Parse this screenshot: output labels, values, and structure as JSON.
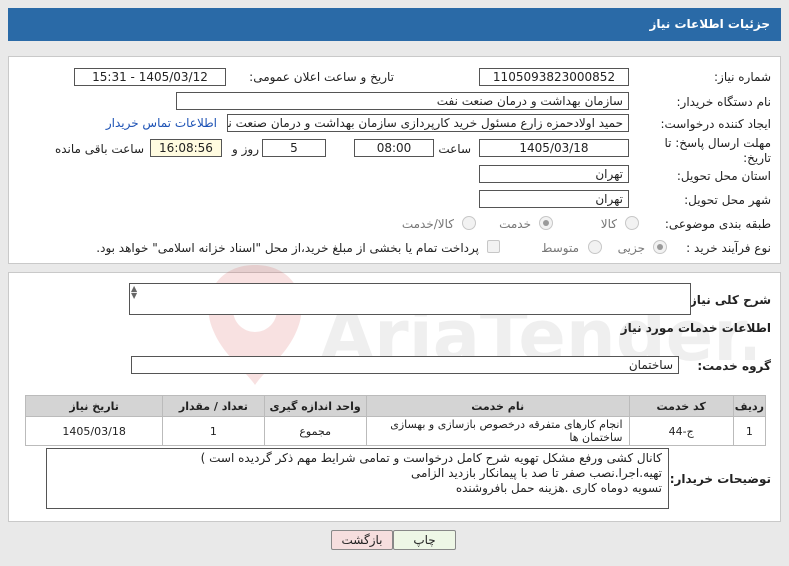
{
  "header": {
    "title": "جزئیات اطلاعات نیاز"
  },
  "form": {
    "need_number_label": "شماره نیاز:",
    "need_number": "1105093823000852",
    "announce_label": "تاریخ و ساعت اعلان عمومی:",
    "announce_value": "1405/03/12 - 15:31",
    "buyer_org_label": "نام دستگاه خریدار:",
    "buyer_org": "سازمان بهداشت و درمان صنعت نفت",
    "creator_label": "ایجاد کننده درخواست:",
    "creator": "حمید اولادحمزه زارع مسئول خرید کارپردازی سازمان بهداشت و درمان صنعت نفت",
    "contact_link": "اطلاعات تماس خریدار",
    "deadline_label": "مهلت ارسال پاسخ: تا تاریخ:",
    "deadline_date": "1405/03/18",
    "time_label": "ساعت",
    "deadline_time": "08:00",
    "days_value": "5",
    "days_label": "روز و",
    "remaining_time": "16:08:56",
    "remaining_label": "ساعت باقی مانده",
    "province_label": "استان محل تحویل:",
    "province": "تهران",
    "city_label": "شهر محل تحویل:",
    "city": "تهران",
    "category_label": "طبقه بندی موضوعی:",
    "category_options": [
      "کالا",
      "خدمت",
      "کالا/خدمت"
    ],
    "category_selected": "خدمت",
    "process_label": "نوع فرآیند خرید :",
    "process_options": [
      "جزیی",
      "متوسط"
    ],
    "payment_note": "پرداخت تمام یا بخشی از مبلغ خرید،از محل \"اسناد خزانه اسلامی\" خواهد بود."
  },
  "description": {
    "label": "شرح کلی نیاز:",
    "value": ""
  },
  "services": {
    "section_title": "اطلاعات خدمات مورد نیاز",
    "group_label": "گروه خدمت:",
    "group_value": "ساختمان",
    "table": {
      "headers": [
        "ردیف",
        "کد خدمت",
        "نام خدمت",
        "واحد اندازه گیری",
        "تعداد / مقدار",
        "تاریخ نیاز"
      ],
      "rows": [
        [
          "1",
          "ج-44",
          "انجام کارهای متفرقه درخصوص بازسازی و بهسازی ساختمان ها",
          "مجموع",
          "1",
          "1405/03/18"
        ]
      ]
    }
  },
  "buyer_notes": {
    "label": "توضیحات خریدار:",
    "lines": [
      "کانال کشی ورفع مشکل تهویه شرح کامل درخواست و تمامی شرایط مهم ذکر گردیده است )",
      "تهیه.اجرا.نصب صفر تا صد با پیمانکار بازدید الزامی",
      "تسویه دوماه کاری .هزینه حمل بافروشنده"
    ]
  },
  "buttons": {
    "print": "چاپ",
    "back": "بازگشت"
  },
  "watermark_text": "AriaTender.net",
  "colors": {
    "title_bar": "#2a6aa7",
    "link": "#1d52b5",
    "back_button": "#f6dede",
    "print_button": "#eef7e6"
  }
}
